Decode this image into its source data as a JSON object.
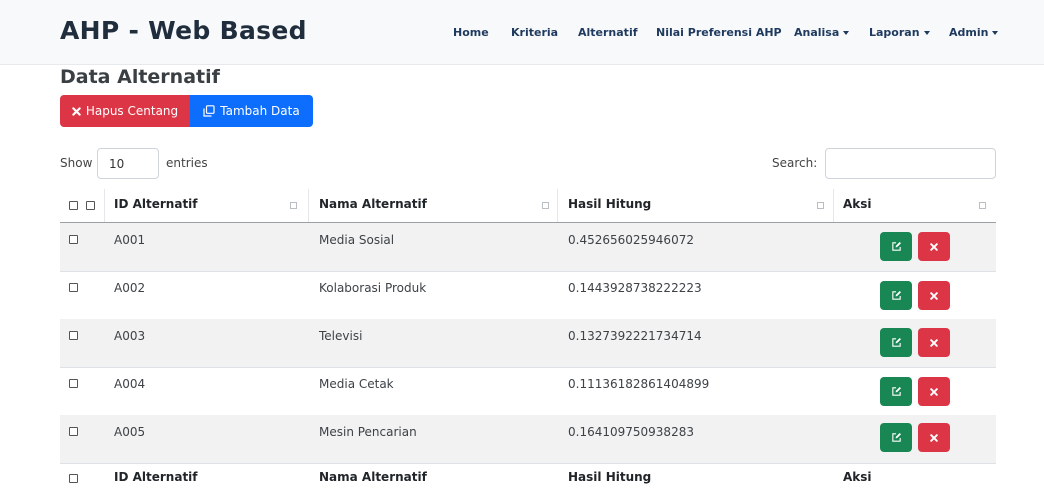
{
  "app": {
    "brand": "AHP - Web Based"
  },
  "nav": {
    "home": "Home",
    "kriteria": "Kriteria",
    "alternatif": "Alternatif",
    "nilai": "Nilai Preferensi AHP",
    "analisa": "Analisa",
    "laporan": "Laporan",
    "admin": "Admin"
  },
  "page": {
    "title": "Data Alternatif",
    "btn_hapus": "Hapus Centang",
    "btn_tambah": "Tambah Data",
    "show_label": "Show",
    "entries_value": "10",
    "entries_label": "entries",
    "search_label": "Search:",
    "search_value": ""
  },
  "table": {
    "headers": {
      "id": "ID Alternatif",
      "nama": "Nama Alternatif",
      "hasil": "Hasil Hitung",
      "aksi": "Aksi"
    },
    "rows": [
      {
        "id": "A001",
        "nama": "Media Sosial",
        "hasil": "0.452656025946072"
      },
      {
        "id": "A002",
        "nama": "Kolaborasi Produk",
        "hasil": "0.1443928738222223"
      },
      {
        "id": "A003",
        "nama": "Televisi",
        "hasil": "0.1327392221734714"
      },
      {
        "id": "A004",
        "nama": "Media Cetak",
        "hasil": "0.11136182861404899"
      },
      {
        "id": "A005",
        "nama": "Mesin Pencarian",
        "hasil": "0.164109750938283"
      }
    ]
  },
  "colors": {
    "danger": "#dc3545",
    "primary": "#0d6efd",
    "success": "#198754"
  }
}
